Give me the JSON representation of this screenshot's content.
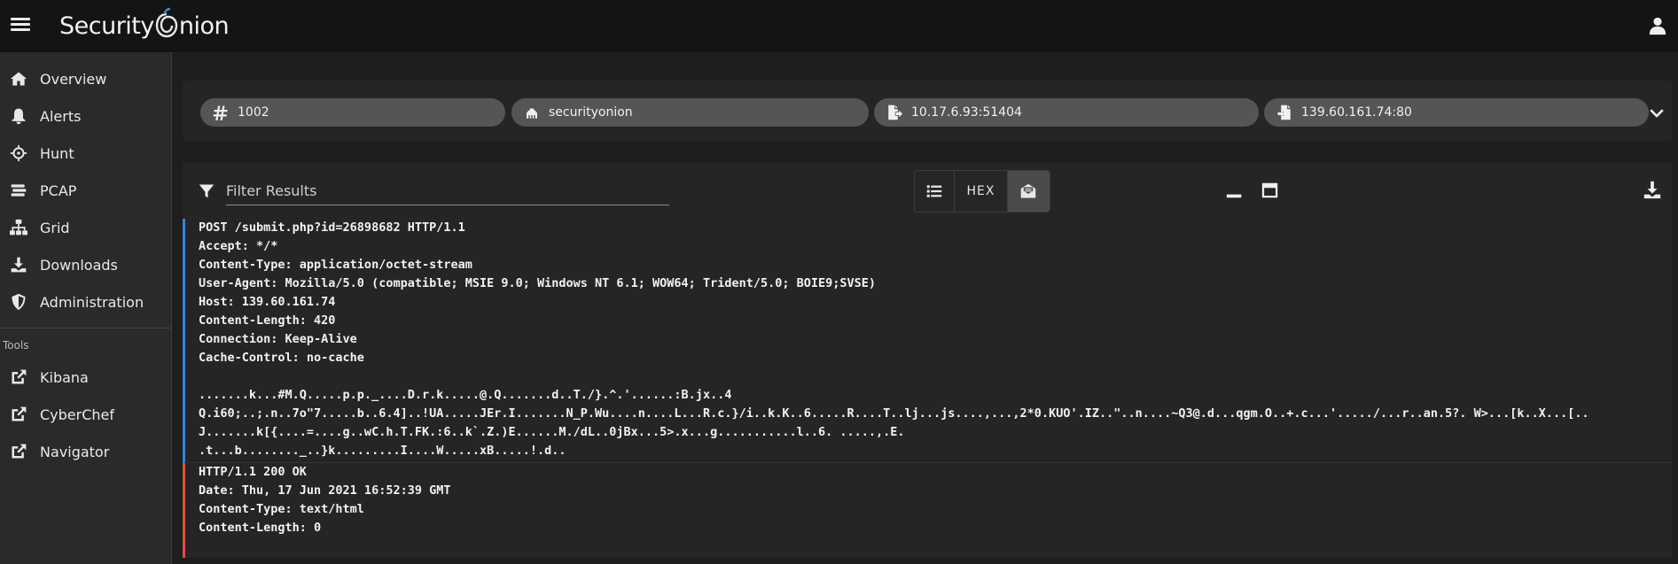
{
  "app": {
    "brand_left": "Security",
    "brand_right": "nion"
  },
  "sidebar": {
    "items": [
      {
        "label": "Overview",
        "icon": "home-icon"
      },
      {
        "label": "Alerts",
        "icon": "bell-icon"
      },
      {
        "label": "Hunt",
        "icon": "crosshairs-icon"
      },
      {
        "label": "PCAP",
        "icon": "stream-icon"
      },
      {
        "label": "Grid",
        "icon": "network-icon"
      },
      {
        "label": "Downloads",
        "icon": "download-icon"
      },
      {
        "label": "Administration",
        "icon": "shield-icon"
      }
    ],
    "tools_label": "Tools",
    "tools": [
      {
        "label": "Kibana",
        "icon": "external-link-icon"
      },
      {
        "label": "CyberChef",
        "icon": "external-link-icon"
      },
      {
        "label": "Navigator",
        "icon": "external-link-icon"
      }
    ]
  },
  "connection": {
    "id": "1002",
    "sensor": "securityonion",
    "source": "10.17.6.93:51404",
    "destination": "139.60.161.74:80"
  },
  "toolbar": {
    "filter_placeholder": "Filter Results",
    "hex_label": "HEX"
  },
  "transcript": {
    "request_headers": [
      "POST /submit.php?id=26898682 HTTP/1.1",
      "Accept: */*",
      "Content-Type: application/octet-stream",
      "User-Agent: Mozilla/5.0 (compatible; MSIE 9.0; Windows NT 6.1; WOW64; Trident/5.0; BOIE9;SVSE)",
      "Host: 139.60.161.74",
      "Content-Length: 420",
      "Connection: Keep-Alive",
      "Cache-Control: no-cache"
    ],
    "request_body": [
      ".......k...#M.Q.....p.p._....D.r.k.....@.Q.......d..T./}.^.'......:B.jx..4",
      "Q.i60;..;.n..7o\"7.....b..6.4]..!UA.....JEr.I.......N_P.Wu....n....L...R.c.}/i..k.K..6.....R....T..lj...js....,...,2*0.KUO'.IZ..\"..n....~Q3@.d...qgm.O..+.c...'...../...r..an.5?. W>...[k..X...[..",
      "J.......k[{....=....g..wC.h.T.FK.:6..k`.Z.)E......M./dL..0jBx...5>.x...g...........l..6. .....,.E.",
      ".t...b........_..}k.........I....W.....xB.....!.d.."
    ],
    "response_headers": [
      "HTTP/1.1 200 OK",
      "Date: Thu, 17 Jun 2021 16:52:39 GMT",
      "Content-Type: text/html",
      "Content-Length: 0"
    ]
  },
  "colors": {
    "request_border": "#2e86de",
    "response_border": "#e74c3c"
  }
}
